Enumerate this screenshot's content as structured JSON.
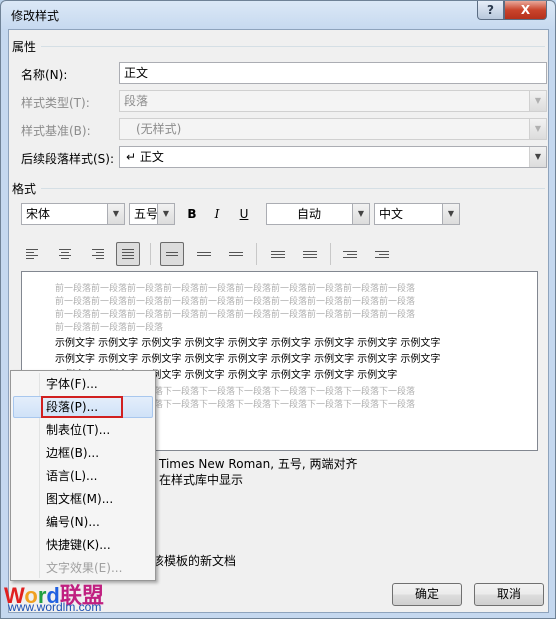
{
  "window": {
    "title": "修改样式"
  },
  "titlebar": {
    "help_label": "?",
    "close_label": "X"
  },
  "properties": {
    "heading": "属性",
    "name_label": "名称(N):",
    "name_value": "正文",
    "style_type_label": "样式类型(T):",
    "style_type_value": "段落",
    "style_based_label": "样式基准(B):",
    "style_based_value": "(无样式)",
    "next_style_label": "后续段落样式(S):",
    "next_style_value": "↵ 正文"
  },
  "format": {
    "heading": "格式",
    "font": "宋体",
    "size": "五号",
    "bold": "B",
    "italic": "I",
    "underline": "U",
    "color": "自动",
    "lang": "中文"
  },
  "preview": {
    "prev_lines": [
      "前一段落前一段落前一段落前一段落前一段落前一段落前一段落前一段落前一段落前一段落",
      "前一段落前一段落前一段落前一段落前一段落前一段落前一段落前一段落前一段落前一段落",
      "前一段落前一段落前一段落前一段落前一段落前一段落前一段落前一段落前一段落前一段落",
      "前一段落前一段落前一段落"
    ],
    "sample_lines": [
      "示例文字 示例文字 示例文字 示例文字 示例文字 示例文字 示例文字 示例文字 示例文字",
      "示例文字 示例文字 示例文字 示例文字 示例文字 示例文字 示例文字 示例文字 示例文字",
      "示例文字 示例文字 示例文字 示例文字 示例文字 示例文字 示例文字 示例文字"
    ],
    "next_lines": [
      "下一段落下一段落下一段落下一段落下一段落下一段落下一段落下一段落下一段落下一段落",
      "下一段落下一段落下一段落下一段落下一段落下一段落下一段落下一段落下一段落下一段落"
    ]
  },
  "description": {
    "line1": "Times New Roman, 五号, 两端对齐",
    "line2": "在样式库中显示",
    "template_option": "该模板的新文档"
  },
  "buttons": {
    "ok": "确定",
    "cancel": "取消"
  },
  "menu": {
    "items": [
      {
        "label": "字体(F)..."
      },
      {
        "label": "段落(P)..."
      },
      {
        "label": "制表位(T)..."
      },
      {
        "label": "边框(B)..."
      },
      {
        "label": "语言(L)..."
      },
      {
        "label": "图文框(M)..."
      },
      {
        "label": "编号(N)..."
      },
      {
        "label": "快捷键(K)..."
      },
      {
        "label": "文字效果(E)..."
      }
    ]
  },
  "watermark": {
    "logo": "Word联盟",
    "url": "www.wordlm.com"
  }
}
